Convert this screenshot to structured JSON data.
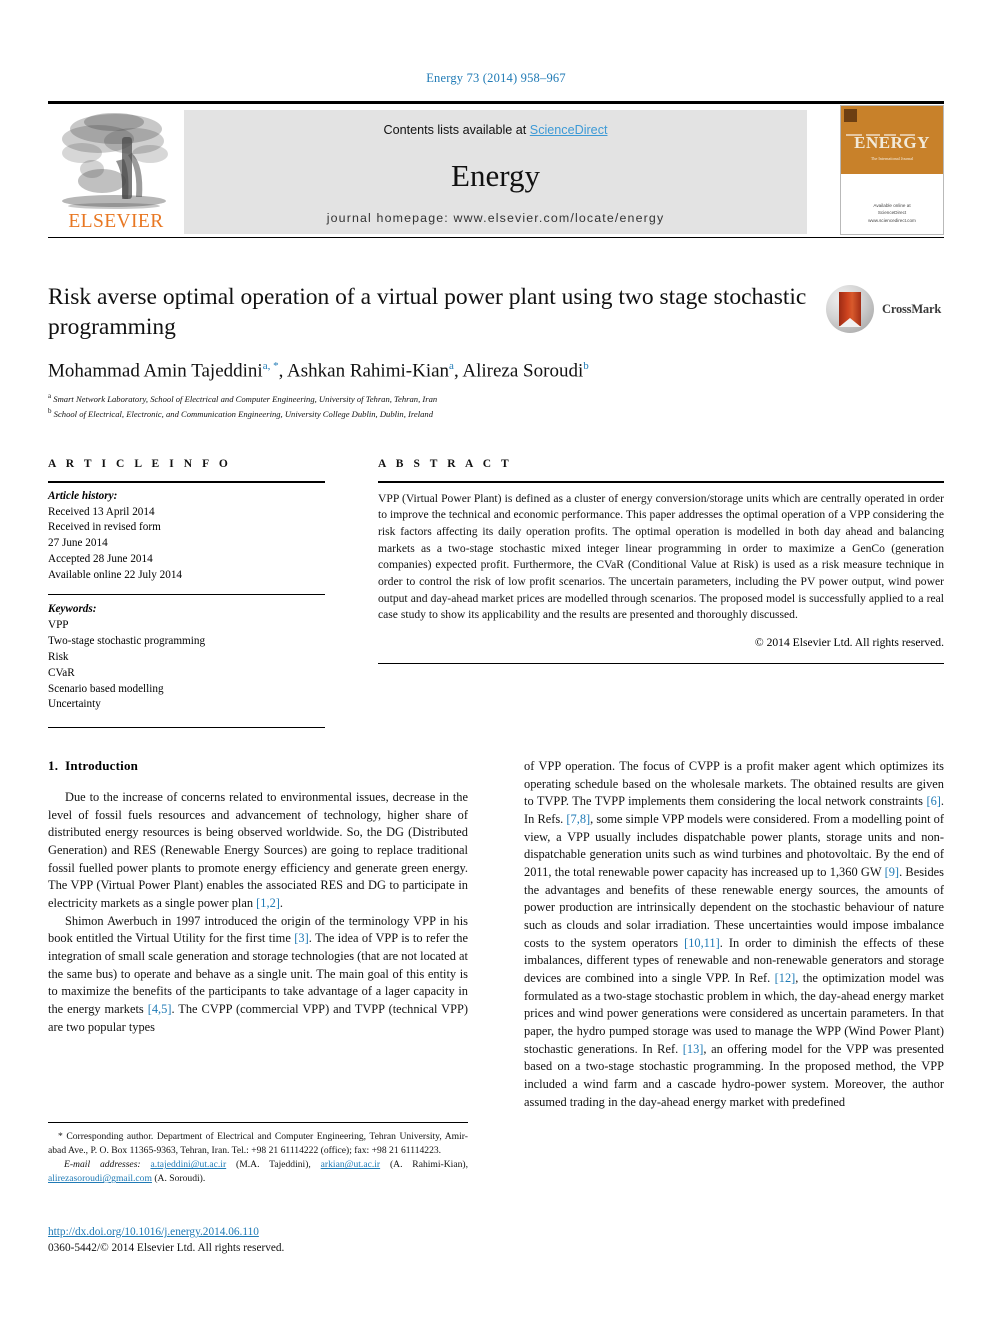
{
  "running_head": "Energy 73 (2014) 958–967",
  "masthead": {
    "contents_prefix": "Contents lists available at ",
    "sciencedirect": "ScienceDirect",
    "journal_title": "Energy",
    "homepage": "journal homepage: www.elsevier.com/locate/energy",
    "publisher_name": "ELSEVIER",
    "cover": {
      "title": "ENERGY",
      "tagline": "The International Journal",
      "footer_line1": "Available online at",
      "footer_line2": "ScienceDirect",
      "footer_line3": "www.sciencedirect.com"
    }
  },
  "article": {
    "title": "Risk averse optimal operation of a virtual power plant using two stage stochastic programming",
    "crossmark_label": "CrossMark",
    "authors": [
      {
        "name": "Mohammad Amin Tajeddini",
        "marks": "a, *"
      },
      {
        "name": "Ashkan Rahimi-Kian",
        "marks": "a"
      },
      {
        "name": "Alireza Soroudi",
        "marks": "b"
      }
    ],
    "affiliations": [
      {
        "mark": "a",
        "text": "Smart Network Laboratory, School of Electrical and Computer Engineering, University of Tehran, Tehran, Iran"
      },
      {
        "mark": "b",
        "text": "School of Electrical, Electronic, and Communication Engineering, University College Dublin, Dublin, Ireland"
      }
    ]
  },
  "article_info": {
    "heading": "A R T I C L E   I N F O",
    "history_label": "Article history:",
    "history": [
      "Received 13 April 2014",
      "Received in revised form",
      "27 June 2014",
      "Accepted 28 June 2014",
      "Available online 22 July 2014"
    ],
    "keywords_label": "Keywords:",
    "keywords": [
      "VPP",
      "Two-stage stochastic programming",
      "Risk",
      "CVaR",
      "Scenario based modelling",
      "Uncertainty"
    ]
  },
  "abstract": {
    "heading": "A B S T R A C T",
    "text": "VPP (Virtual Power Plant) is defined as a cluster of energy conversion/storage units which are centrally operated in order to improve the technical and economic performance. This paper addresses the optimal operation of a VPP considering the risk factors affecting its daily operation profits. The optimal operation is modelled in both day ahead and balancing markets as a two-stage stochastic mixed integer linear programming in order to maximize a GenCo (generation companies) expected profit. Furthermore, the CVaR (Conditional Value at Risk) is used as a risk measure technique in order to control the risk of low profit scenarios. The uncertain parameters, including the PV power output, wind power output and day-ahead market prices are modelled through scenarios. The proposed model is successfully applied to a real case study to show its applicability and the results are presented and thoroughly discussed.",
    "copyright": "© 2014 Elsevier Ltd. All rights reserved."
  },
  "body": {
    "section_number": "1.",
    "section_title": "Introduction",
    "left_paragraphs": [
      "Due to the increase of concerns related to environmental issues, decrease in the level of fossil fuels resources and advancement of technology, higher share of distributed energy resources is being observed worldwide. So, the DG (Distributed Generation) and RES (Renewable Energy Sources) are going to replace traditional fossil fuelled power plants to promote energy efficiency and generate green energy. The VPP (Virtual Power Plant) enables the associated RES and DG to participate in electricity markets as a single power plan [1,2].",
      "Shimon Awerbuch in 1997 introduced the origin of the terminology VPP in his book entitled the Virtual Utility for the first time [3]. The idea of VPP is to refer the integration of small scale generation and storage technologies (that are not located at the same bus) to operate and behave as a single unit. The main goal of this entity is to maximize the benefits of the participants to take advantage of a lager capacity in the energy markets [4,5]. The CVPP (commercial VPP) and TVPP (technical VPP) are two popular types"
    ],
    "right_paragraphs": [
      "of VPP operation. The focus of CVPP is a profit maker agent which optimizes its operating schedule based on the wholesale markets. The obtained results are given to TVPP. The TVPP implements them considering the local network constraints [6]. In Refs. [7,8], some simple VPP models were considered. From a modelling point of view, a VPP usually includes dispatchable power plants, storage units and non-dispatchable generation units such as wind turbines and photovoltaic. By the end of 2011, the total renewable power capacity has increased up to 1,360 GW [9]. Besides the advantages and benefits of these renewable energy sources, the amounts of power production are intrinsically dependent on the stochastic behaviour of nature such as clouds and solar irradiation. These uncertainties would impose imbalance costs to the system operators [10,11]. In order to diminish the effects of these imbalances, different types of renewable and non-renewable generators and storage devices are combined into a single VPP. In Ref. [12], the optimization model was formulated as a two-stage stochastic problem in which, the day-ahead energy market prices and wind power generations were considered as uncertain parameters. In that paper, the hydro pumped storage was used to manage the WPP (Wind Power Plant) stochastic generations. In Ref. [13], an offering model for the VPP was presented based on a two-stage stochastic programming. In the proposed method, the VPP included a wind farm and a cascade hydro-power system. Moreover, the author assumed trading in the day-ahead energy market with predefined"
    ]
  },
  "footnote": {
    "corresponding": "* Corresponding author. Department of Electrical and Computer Engineering, Tehran University, Amir-abad Ave., P. O. Box 11365-9363, Tehran, Iran. Tel.: +98 21 61114222 (office); fax: +98 21 61114223.",
    "email_label": "E-mail addresses:",
    "emails": [
      {
        "address": "a.tajeddini@ut.ac.ir",
        "owner": "(M.A. Tajeddini),"
      },
      {
        "address": "arkian@ut.ac.ir",
        "owner": "(A. Rahimi-Kian),"
      },
      {
        "address": "alirezasoroudi@gmail.com",
        "owner": "(A. Soroudi)."
      }
    ],
    "doi": "http://dx.doi.org/10.1016/j.energy.2014.06.110",
    "issn": "0360-5442/© 2014 Elsevier Ltd. All rights reserved."
  },
  "colors": {
    "link": "#1f7ab5",
    "sciencedirect": "#3d9ad6",
    "elsevier_orange": "#E87722",
    "cover_orange": "#C8812A"
  }
}
